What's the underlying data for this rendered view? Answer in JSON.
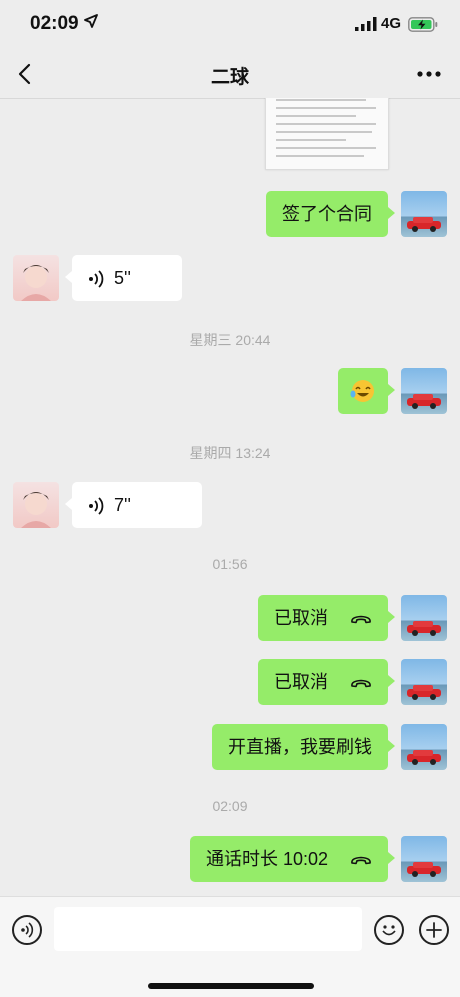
{
  "status_bar": {
    "time": "02:09",
    "network": "4G"
  },
  "header": {
    "title": "二球"
  },
  "messages": {
    "m1": "签了个合同",
    "m2_duration": "5''",
    "ts1": "星期三 20:44",
    "ts2": "星期四 13:24",
    "m4_duration": "7''",
    "ts3": "01:56",
    "m5": "已取消",
    "m6": "已取消",
    "m7": "开直播，我要刷钱",
    "ts4": "02:09",
    "m8": "通话时长 10:02"
  },
  "colors": {
    "outgoing_bubble": "#95ec69",
    "incoming_bubble": "#ffffff",
    "background": "#ededed"
  },
  "icons": [
    "location-arrow-icon",
    "signal-icon",
    "battery-icon",
    "back-icon",
    "more-icon",
    "voice-icon",
    "phone-hangup-icon",
    "emoji-icon",
    "plus-icon"
  ]
}
